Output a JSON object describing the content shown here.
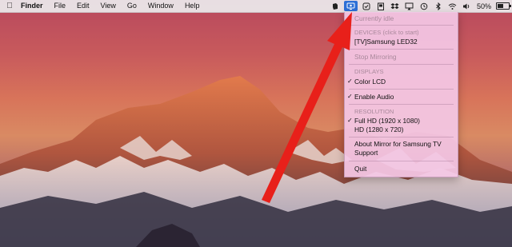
{
  "menubar": {
    "apple_icon": "apple-icon",
    "app_name": "Finder",
    "menus": [
      "File",
      "Edit",
      "View",
      "Go",
      "Window",
      "Help"
    ],
    "status_icons": [
      "evernote-icon",
      "mirror-icon",
      "checkbox-icon",
      "clipboard-icon",
      "dropbox-icon",
      "airplay-icon",
      "time-machine-icon",
      "bluetooth-icon",
      "wifi-icon",
      "volume-icon"
    ],
    "battery_percent_text": "50%",
    "battery_level": 0.5
  },
  "dropdown": {
    "status": "Currently idle",
    "devices_header": "DEVICES (click to start)",
    "device": "[TV]Samsung LED32",
    "stop_mirroring": "Stop Mirroring",
    "displays_header": "DISPLAYS",
    "color_lcd": "Color LCD",
    "enable_audio": "Enable Audio",
    "resolution_header": "RESOLUTION",
    "full_hd": "Full HD  (1920 x 1080)",
    "hd": "HD  (1280 x 720)",
    "about_line1": "About Mirror for Samsung TV",
    "about_line2": "Support",
    "quit": "Quit",
    "checkmark": "✓"
  },
  "colors": {
    "highlight_blue": "#2d6fd6",
    "menu_pink": "#f4c8e6",
    "arrow_red": "#e8201a"
  }
}
